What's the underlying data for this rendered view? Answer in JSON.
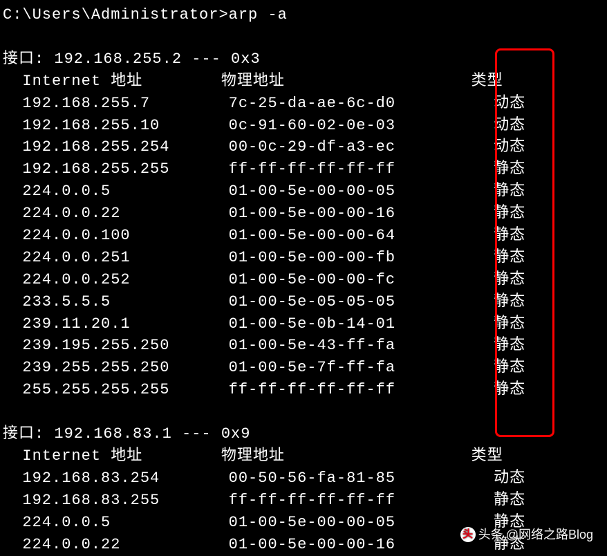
{
  "prompt": "C:\\Users\\Administrator>arp -a",
  "interface1": {
    "header": "接口: 192.168.255.2 --- 0x3",
    "col_internet": "  Internet 地址",
    "col_physical": "物理地址",
    "col_type": "类型",
    "rows": [
      {
        "ip": "  192.168.255.7",
        "mac": "7c-25-da-ae-6c-d0",
        "type": "动态"
      },
      {
        "ip": "  192.168.255.10",
        "mac": "0c-91-60-02-0e-03",
        "type": "动态"
      },
      {
        "ip": "  192.168.255.254",
        "mac": "00-0c-29-df-a3-ec",
        "type": "动态"
      },
      {
        "ip": "  192.168.255.255",
        "mac": "ff-ff-ff-ff-ff-ff",
        "type": "静态"
      },
      {
        "ip": "  224.0.0.5",
        "mac": "01-00-5e-00-00-05",
        "type": "静态"
      },
      {
        "ip": "  224.0.0.22",
        "mac": "01-00-5e-00-00-16",
        "type": "静态"
      },
      {
        "ip": "  224.0.0.100",
        "mac": "01-00-5e-00-00-64",
        "type": "静态"
      },
      {
        "ip": "  224.0.0.251",
        "mac": "01-00-5e-00-00-fb",
        "type": "静态"
      },
      {
        "ip": "  224.0.0.252",
        "mac": "01-00-5e-00-00-fc",
        "type": "静态"
      },
      {
        "ip": "  233.5.5.5",
        "mac": "01-00-5e-05-05-05",
        "type": "静态"
      },
      {
        "ip": "  239.11.20.1",
        "mac": "01-00-5e-0b-14-01",
        "type": "静态"
      },
      {
        "ip": "  239.195.255.250",
        "mac": "01-00-5e-43-ff-fa",
        "type": "静态"
      },
      {
        "ip": "  239.255.255.250",
        "mac": "01-00-5e-7f-ff-fa",
        "type": "静态"
      },
      {
        "ip": "  255.255.255.255",
        "mac": "ff-ff-ff-ff-ff-ff",
        "type": "静态"
      }
    ]
  },
  "interface2": {
    "header": "接口: 192.168.83.1 --- 0x9",
    "col_internet": "  Internet 地址",
    "col_physical": "物理地址",
    "col_type": "类型",
    "rows": [
      {
        "ip": "  192.168.83.254",
        "mac": "00-50-56-fa-81-85",
        "type": "动态"
      },
      {
        "ip": "  192.168.83.255",
        "mac": "ff-ff-ff-ff-ff-ff",
        "type": "静态"
      },
      {
        "ip": "  224.0.0.5",
        "mac": "01-00-5e-00-00-05",
        "type": "静态"
      },
      {
        "ip": "  224.0.0.22",
        "mac": "01-00-5e-00-00-16",
        "type": "静态"
      }
    ]
  },
  "watermark": {
    "prefix": "头条",
    "author": "@网络之路Blog"
  }
}
